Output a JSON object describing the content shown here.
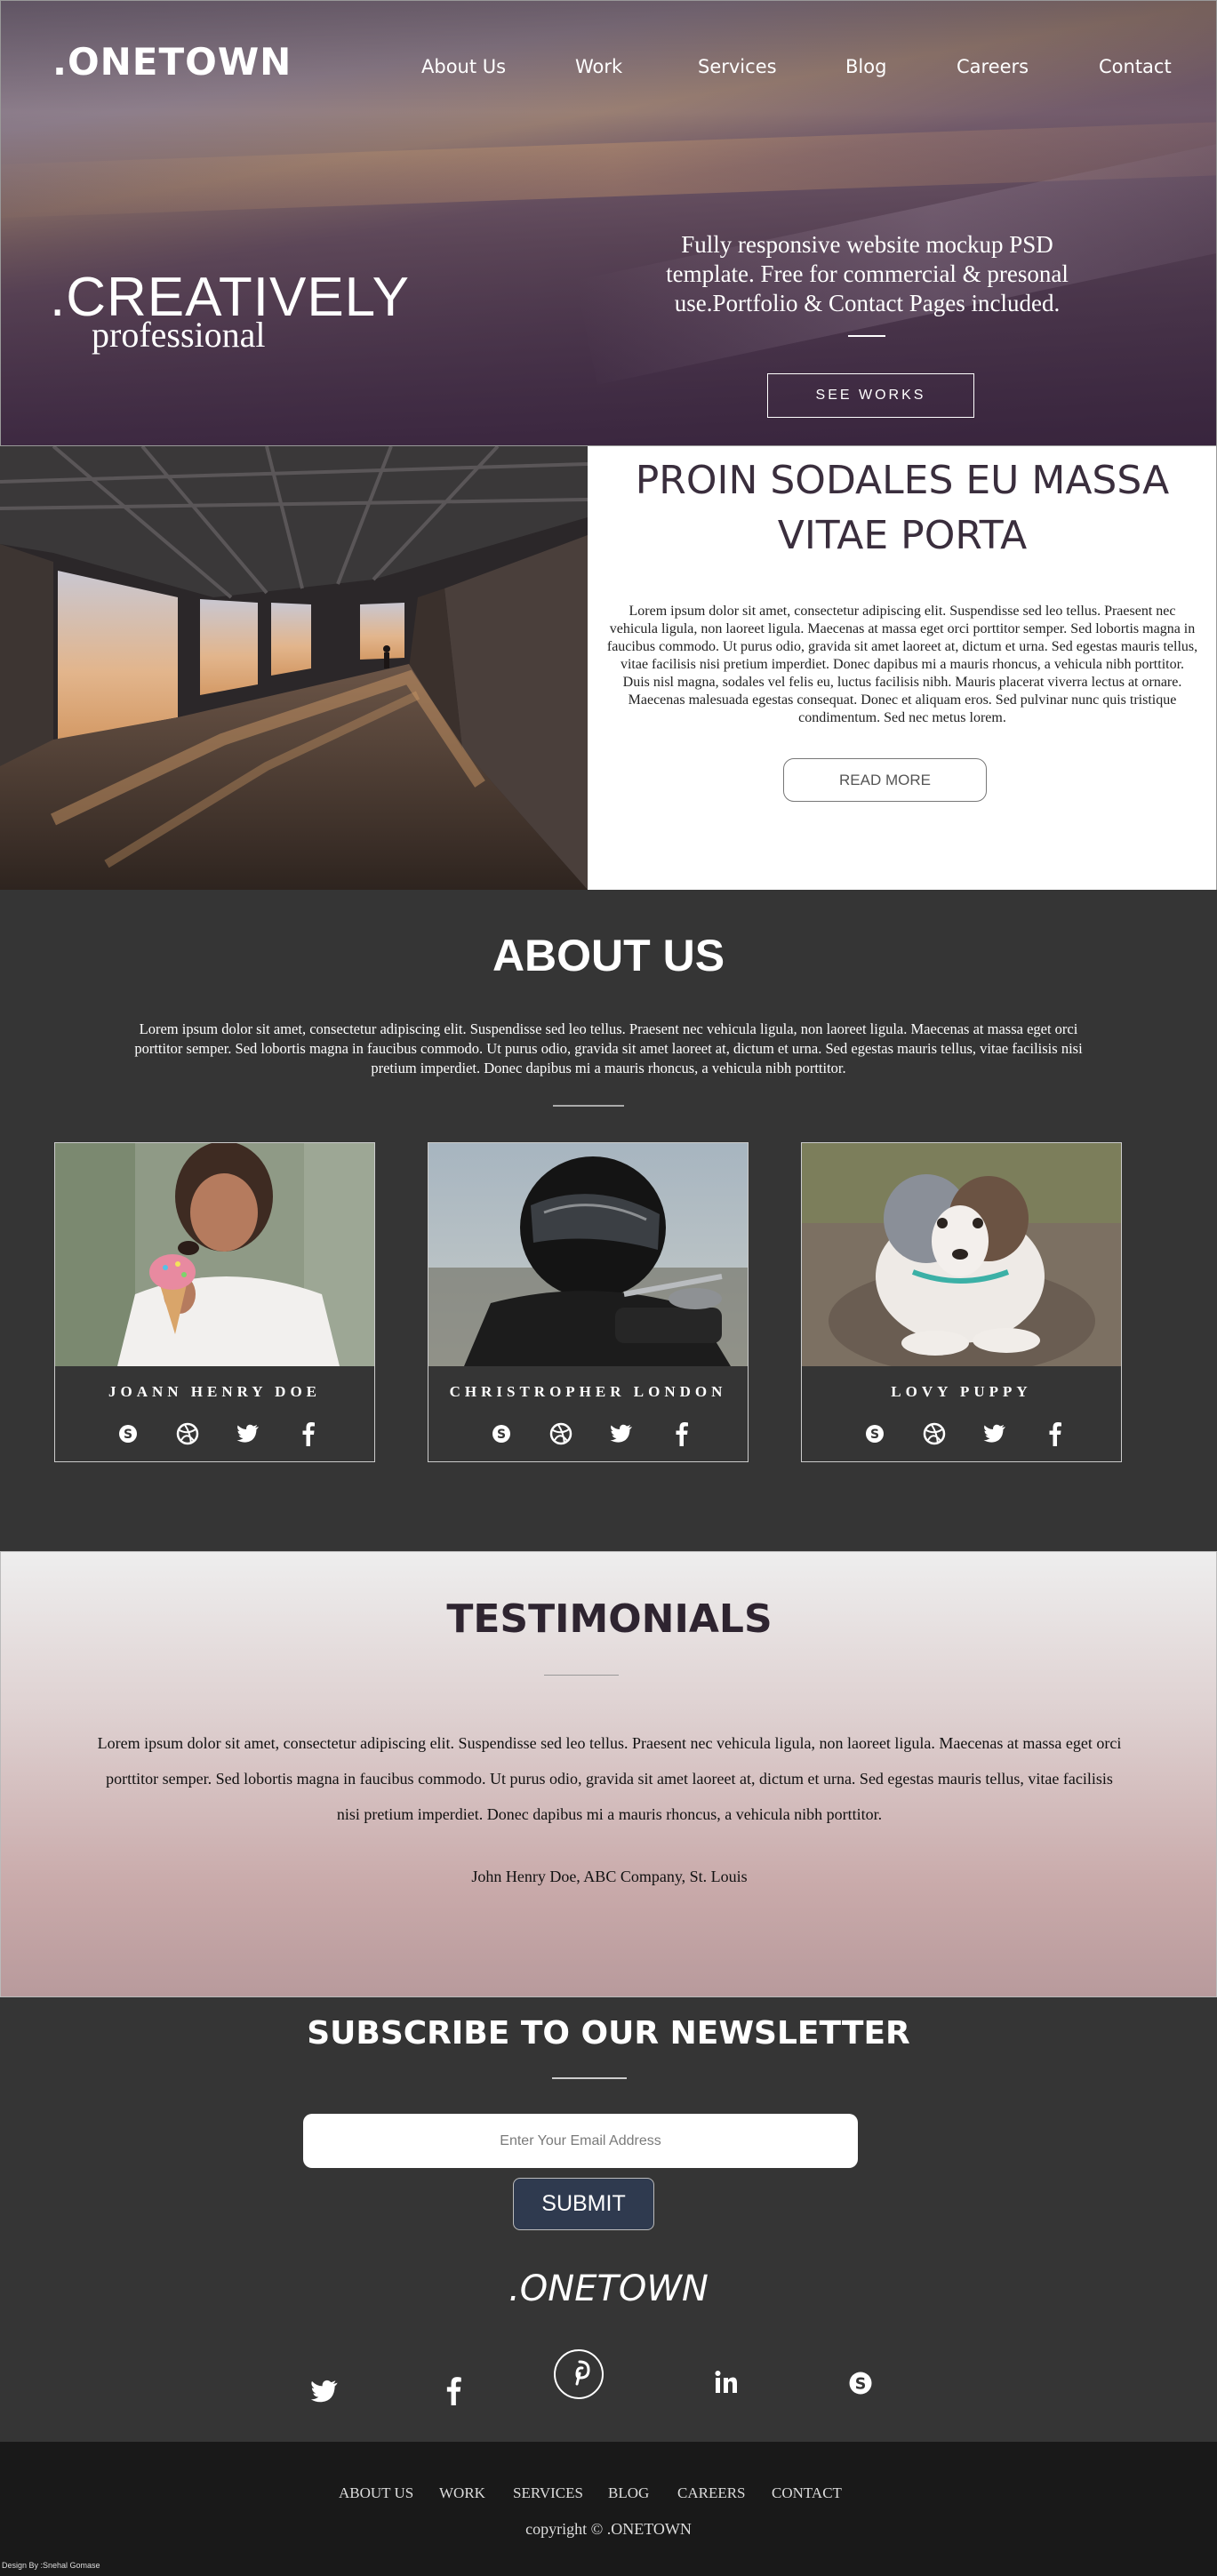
{
  "header": {
    "logo": ".ONETOWN",
    "nav": [
      "About Us",
      "Work",
      "Services",
      "Blog",
      "Careers",
      "Contact"
    ]
  },
  "hero": {
    "headline": ".CREATIVELY",
    "subheadline": "professional",
    "tagline": "Fully responsive website mockup PSD template. Free for commercial & presonal use.Portfolio & Contact Pages included.",
    "button": "SEE WORKS"
  },
  "feature": {
    "title": "PROIN SODALES EU MASSA VITAE PORTA",
    "text": "Lorem ipsum dolor sit amet, consectetur adipiscing elit. Suspendisse sed leo tellus. Praesent nec vehicula ligula, non laoreet ligula. Maecenas at massa eget orci porttitor semper. Sed lobortis magna in faucibus commodo. Ut purus odio, gravida sit amet laoreet at, dictum et urna. Sed egestas mauris tellus, vitae facilisis nisi pretium imperdiet. Donec dapibus mi a mauris rhoncus, a vehicula nibh porttitor. Duis nisl magna, sodales vel felis eu, luctus facilisis nibh. Mauris placerat viverra lectus at ornare. Maecenas malesuada egestas consequat. Donec et aliquam eros. Sed pulvinar nunc quis tristique condimentum. Sed nec metus lorem.",
    "button": "READ MORE"
  },
  "about": {
    "title": "ABOUT US",
    "text": "Lorem ipsum dolor sit amet, consectetur adipiscing elit. Suspendisse sed leo tellus. Praesent nec vehicula ligula, non laoreet ligula. Maecenas at massa eget orci porttitor semper. Sed lobortis magna in faucibus commodo. Ut purus odio, gravida sit amet laoreet at, dictum et urna. Sed egestas mauris tellus, vitae facilisis nisi pretium imperdiet. Donec dapibus mi a mauris rhoncus, a vehicula nibh porttitor.",
    "cards": [
      {
        "name": "JOANN HENRY DOE"
      },
      {
        "name": "CHRISTROPHER LONDON"
      },
      {
        "name": "LOVY PUPPY"
      }
    ],
    "card_icons": [
      "skype-icon",
      "dribbble-icon",
      "twitter-icon",
      "facebook-icon"
    ]
  },
  "testimonials": {
    "title": "TESTIMONIALS",
    "text": "Lorem ipsum dolor sit amet, consectetur adipiscing elit. Suspendisse sed leo tellus. Praesent nec vehicula ligula, non laoreet ligula. Maecenas at massa eget orci porttitor semper. Sed lobortis magna in faucibus commodo. Ut purus odio, gravida sit amet laoreet at, dictum et urna. Sed egestas mauris tellus, vitae facilisis nisi pretium imperdiet. Donec dapibus mi a mauris rhoncus, a vehicula nibh porttitor.",
    "author": "John Henry Doe, ABC Company, St. Louis"
  },
  "newsletter": {
    "title": "SUBSCRIBE TO OUR NEWSLETTER",
    "placeholder": "Enter Your Email Address",
    "button": "SUBMIT",
    "logo": ".ONETOWN",
    "social_icons": [
      "twitter-icon",
      "facebook-icon",
      "pinterest-icon",
      "linkedin-icon",
      "skype-icon"
    ]
  },
  "footer": {
    "nav": [
      "ABOUT US",
      "WORK",
      "SERVICES",
      "BLOG",
      "CAREERS",
      "CONTACT"
    ],
    "copyright": "copyright © .ONETOWN",
    "credit": "Design By :Snehal Gomase"
  },
  "colors": {
    "dark_section": "#353535",
    "footer": "#191919",
    "submit_button": "#2f3a4f",
    "heading_plum": "#3a2e3d"
  }
}
